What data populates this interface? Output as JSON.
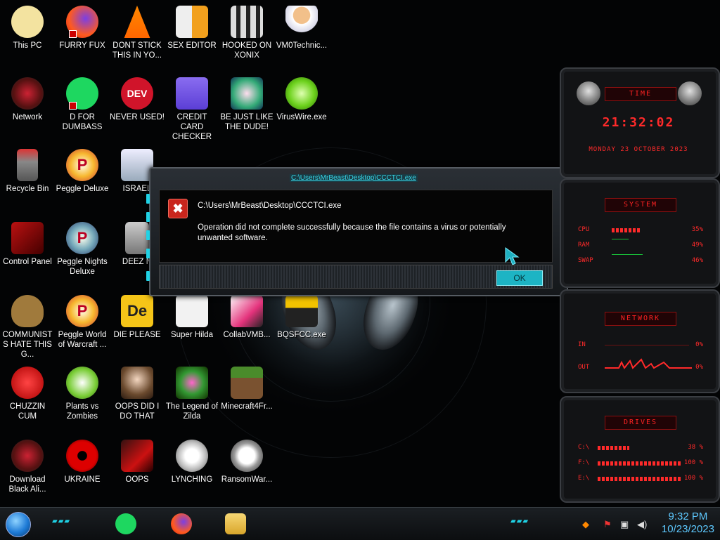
{
  "desktop_icons": [
    {
      "label": "This PC"
    },
    {
      "label": "FURRY FUX"
    },
    {
      "label": "DONT STICK THIS IN YO..."
    },
    {
      "label": "SEX EDITOR"
    },
    {
      "label": "HOOKED ON XONIX"
    },
    {
      "label": "VM0Technic..."
    },
    {
      "label": "Network"
    },
    {
      "label": "D FOR DUMBASS"
    },
    {
      "label": "NEVER USED!"
    },
    {
      "label": "CREDIT CARD CHECKER"
    },
    {
      "label": "BE JUST LIKE THE DUDE!"
    },
    {
      "label": "VirusWire.exe"
    },
    {
      "label": "Recycle Bin"
    },
    {
      "label": "Peggle Deluxe"
    },
    {
      "label": "ISRAEL"
    },
    {
      "label": "Control Panel"
    },
    {
      "label": "Peggle Nights Deluxe"
    },
    {
      "label": "DEEZ N"
    },
    {
      "label": "COMMUNISTS HATE THIS G..."
    },
    {
      "label": "Peggle World of Warcraft ..."
    },
    {
      "label": "DIE PLEASE"
    },
    {
      "label": "Super Hilda"
    },
    {
      "label": "CollabVMB..."
    },
    {
      "label": "BQSFCC.exe"
    },
    {
      "label": "CHUZZIN CUM"
    },
    {
      "label": "Plants vs Zombies"
    },
    {
      "label": "OOPS DID I DO THAT"
    },
    {
      "label": "The Legend of Zilda"
    },
    {
      "label": "Minecraft4Fr..."
    },
    {
      "label": "Download Black Ali..."
    },
    {
      "label": "UKRAINE"
    },
    {
      "label": "OOPS"
    },
    {
      "label": "LYNCHING"
    },
    {
      "label": "RansomWar..."
    }
  ],
  "icon_glyphs": {
    "dev": "DEV",
    "de": "De",
    "p": "P"
  },
  "dialog": {
    "title": "C:\\Users\\MrBeast\\Desktop\\CCCTCI.exe",
    "path": "C:\\Users\\MrBeast\\Desktop\\CCCTCI.exe",
    "message": "Operation did not complete successfully because the file contains a virus or potentially unwanted software.",
    "ok_label": "OK"
  },
  "gadgets": {
    "time": {
      "header": "TIME",
      "clock": "21:32:02",
      "date": "MONDAY 23 OCTOBER 2023"
    },
    "system": {
      "header": "SYSTEM",
      "rows": [
        {
          "label": "CPU",
          "value": "35%",
          "level": 0.35
        },
        {
          "label": "RAM",
          "value": "49%",
          "level": 0.49
        },
        {
          "label": "SWAP",
          "value": "46%",
          "level": 0.46
        }
      ]
    },
    "network": {
      "header": "NETWORK",
      "rows": [
        {
          "label": "IN",
          "value": "0%"
        },
        {
          "label": "OUT",
          "value": "0%"
        }
      ]
    },
    "drives": {
      "header": "DRIVES",
      "rows": [
        {
          "label": "C:\\",
          "value": "38 %",
          "level": 0.38
        },
        {
          "label": "F:\\",
          "value": "100 %",
          "level": 1.0
        },
        {
          "label": "E:\\",
          "value": "100 %",
          "level": 1.0
        }
      ]
    }
  },
  "taskbar": {
    "clock_time": "9:32 PM",
    "clock_date": "10/23/2023"
  },
  "colors": {
    "accent": "#1fd2e5",
    "gadget_red": "#ff2a2a",
    "error_red": "#c9261d"
  }
}
